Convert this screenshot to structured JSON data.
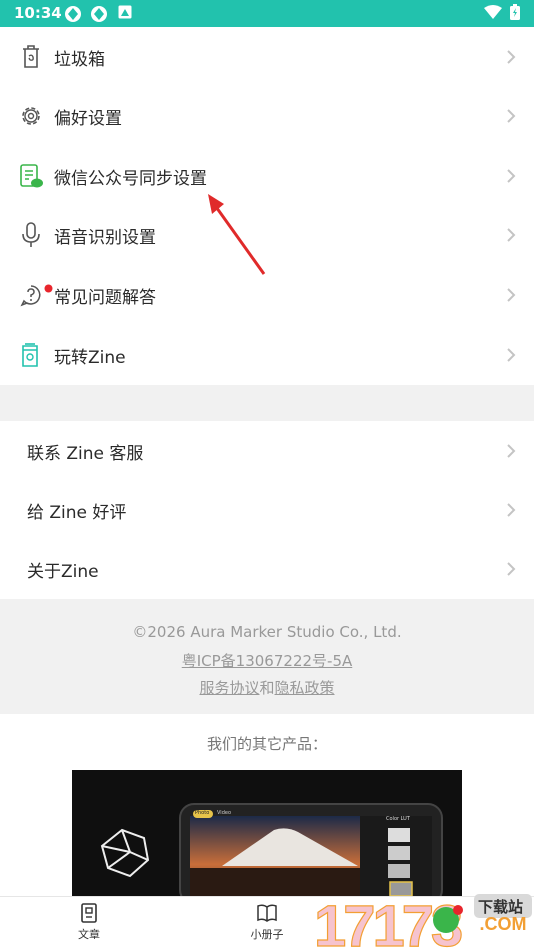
{
  "status_bar": {
    "time": "10:34"
  },
  "menu_section_1": [
    {
      "label": "垃圾箱",
      "icon": "trash-icon"
    },
    {
      "label": "偏好设置",
      "icon": "gear-icon"
    },
    {
      "label": "微信公众号同步设置",
      "icon": "wechat-doc-icon"
    },
    {
      "label": "语音识别设置",
      "icon": "microphone-icon"
    },
    {
      "label": "常见问题解答",
      "icon": "question-icon"
    },
    {
      "label": "玩转Zine",
      "icon": "book-icon"
    }
  ],
  "menu_section_2": [
    {
      "label": "联系 Zine 客服"
    },
    {
      "label": "给 Zine 好评"
    },
    {
      "label": "关于Zine"
    }
  ],
  "footer": {
    "copyright": "©2026 Aura Marker Studio Co., Ltd.",
    "icp": "粤ICP备13067222号-5A",
    "terms": "服务协议",
    "and": "和",
    "privacy": "隐私政策"
  },
  "other_products": {
    "title": "我们的其它产品：",
    "promo_tabs": [
      "Photo",
      "Video"
    ],
    "promo_panel_title": "Color LUT"
  },
  "tab_bar": {
    "articles": "文章",
    "booklets": "小册子"
  },
  "watermark": {
    "badge": "下载站",
    "site": "17173.COM"
  },
  "colors": {
    "accent": "#22c2ad",
    "badge": "#e8252c",
    "icon_green": "#3ab54a"
  }
}
